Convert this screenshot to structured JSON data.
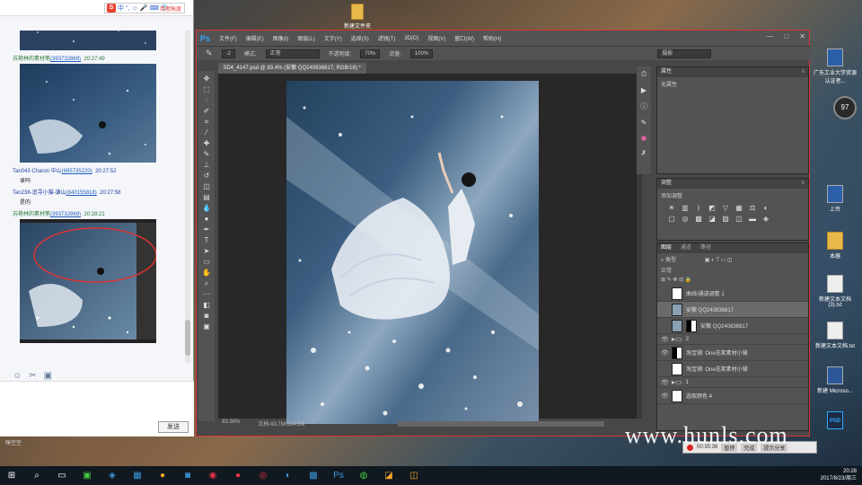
{
  "desktop_top_icon": {
    "label": "新建文件夹"
  },
  "chat": {
    "ime_brand": "S",
    "ime_items": [
      "中",
      "°,",
      "☺",
      "🎤",
      "⌨",
      "👕",
      "⁝"
    ],
    "top_label": "用者高度",
    "messages": [
      {
        "name": "苏艳林的素材笔",
        "qq": "(393732869)",
        "time": "20:27:49"
      },
      {
        "name": "Tan043 Charon 中山",
        "qq": "(695735220)",
        "time": "20:27:52",
        "text": "录吗"
      },
      {
        "name": "Tan238-追寻小猫-谦山",
        "qq": "(840155818)",
        "time": "20:27:58",
        "text": "是的"
      },
      {
        "name": "苏艳林的素材笔",
        "qq": "(393732869)",
        "time": "20:28:21"
      }
    ],
    "send_label": "发送",
    "bottom_label": "咪空空"
  },
  "photoshop": {
    "logo": "Ps",
    "menu": [
      "文件(F)",
      "编辑(E)",
      "图像(I)",
      "图层(L)",
      "文字(Y)",
      "选择(S)",
      "滤镜(T)",
      "3D(D)",
      "视图(V)",
      "窗口(W)",
      "帮助(H)"
    ],
    "options": {
      "mode_label": "模式:",
      "mode_value": "正常",
      "opacity_label": "不透明度:",
      "opacity_value": "70%",
      "flow_label": "流量:",
      "flow_value": "100%",
      "preset": "摄影"
    },
    "doc_tab": "5D4_4147.psd @ 83.4% (安徽 QQ240836817, RGB/16) *",
    "status_zoom": "83.36%",
    "status_doc": "文档:43.7M/314.6M",
    "panels": {
      "properties_title": "属性",
      "properties_body": "无属性",
      "adjust_title": "调整",
      "adjust_body": "添加调整",
      "layers_tabs": [
        "图层",
        "通道",
        "路径"
      ],
      "layers_kind": "类型",
      "layers_blend": "正常",
      "layers": [
        {
          "name": "曲线/通道调整 1",
          "selected": false,
          "type": "adj"
        },
        {
          "name": "安徽 QQ240836817",
          "selected": true,
          "type": "pixel"
        },
        {
          "name": "安徽 QQ240836817",
          "selected": false,
          "type": "pixel-mask"
        },
        {
          "name": "2",
          "selected": false,
          "type": "group"
        },
        {
          "name": "淘宝铺: One花笑素材小铺",
          "selected": false,
          "type": "pixel-mask"
        },
        {
          "name": "淘宝铺: One花笑素材小铺",
          "selected": false,
          "type": "pixel"
        },
        {
          "name": "1",
          "selected": false,
          "type": "group"
        },
        {
          "name": "选取颜色 4",
          "selected": false,
          "type": "adj"
        }
      ]
    }
  },
  "desktop_icons": [
    {
      "label": "广东工业大学资源认证者...",
      "type": "blue"
    },
    {
      "label": "上传",
      "type": "blue"
    },
    {
      "label": "本器",
      "type": "folder"
    },
    {
      "label": "新建文本文档(3).txt",
      "type": "doc"
    },
    {
      "label": "新建文本文档.txt",
      "type": "doc"
    },
    {
      "label": "新建 Microso...",
      "type": "word"
    },
    {
      "label": "PSD",
      "type": "psd"
    }
  ],
  "gauge_value": "97",
  "recorder": {
    "time": "00:35:36",
    "pause": "暂停",
    "stop": "完成",
    "share": "提示分享"
  },
  "watermark": "www.hunls.com",
  "taskbar": {
    "time": "20:28",
    "date": "2017/8/23/周三"
  }
}
